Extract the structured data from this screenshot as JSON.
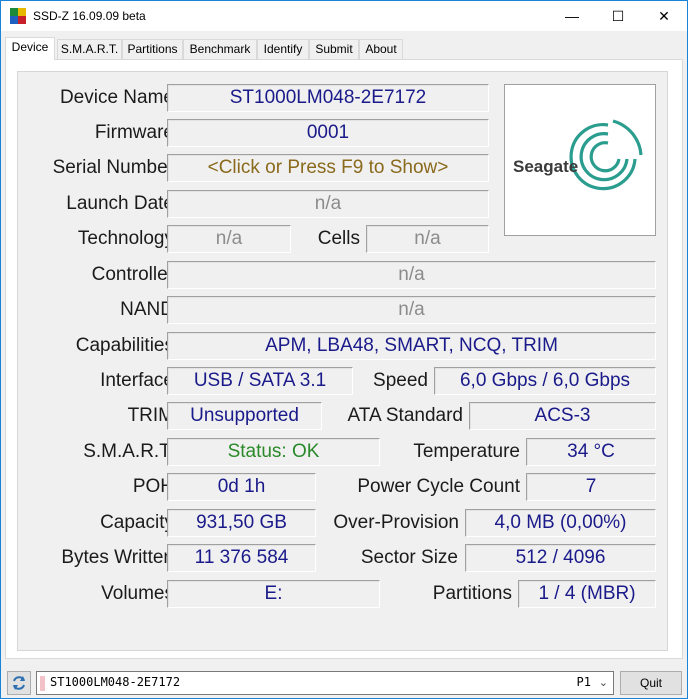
{
  "window": {
    "title": "SSD-Z 16.09.09 beta",
    "minimize": "—",
    "maximize": "☐",
    "close": "✕"
  },
  "tabs": [
    "Device",
    "S.M.A.R.T.",
    "Partitions",
    "Benchmark",
    "Identify",
    "Submit",
    "About"
  ],
  "active_tab": "Device",
  "device": {
    "device_name_label": "Device Name",
    "device_name": "ST1000LM048-2E7172",
    "firmware_label": "Firmware",
    "firmware": "0001",
    "serial_label": "Serial Number",
    "serial": "<Click or Press F9 to Show>",
    "launch_label": "Launch Date",
    "launch": "n/a",
    "technology_label": "Technology",
    "technology": "n/a",
    "cells_label": "Cells",
    "cells": "n/a",
    "controller_label": "Controller",
    "controller": "n/a",
    "nand_label": "NAND",
    "nand": "n/a",
    "capabilities_label": "Capabilities",
    "capabilities": "APM, LBA48, SMART, NCQ, TRIM",
    "interface_label": "Interface",
    "interface": "USB / SATA 3.1",
    "speed_label": "Speed",
    "speed": "6,0 Gbps / 6,0 Gbps",
    "trim_label": "TRIM",
    "trim": "Unsupported",
    "ata_label": "ATA Standard",
    "ata": "ACS-3",
    "smart_label": "S.M.A.R.T.",
    "smart": "Status: OK",
    "temp_label": "Temperature",
    "temp": "34 °C",
    "poh_label": "POH",
    "poh": "0d 1h",
    "pcc_label": "Power Cycle Count",
    "pcc": "7",
    "capacity_label": "Capacity",
    "capacity": "931,50 GB",
    "op_label": "Over-Provision",
    "op": "4,0 MB (0,00%)",
    "bw_label": "Bytes Written",
    "bw": "11 376 584",
    "sector_label": "Sector Size",
    "sector": "512 / 4096",
    "volumes_label": "Volumes",
    "volumes": "E:",
    "partitions_label": "Partitions",
    "partitions": "1 / 4 (MBR)",
    "logo_text": "Seagate"
  },
  "bottom": {
    "drive": "ST1000LM048-2E7172",
    "port": "P1",
    "quit": "Quit"
  },
  "colors": {
    "accent_border": "#1883d7",
    "value_text": "#1a1a8a",
    "ok_text": "#2a8a2a",
    "click_text": "#8a6a1c",
    "na_text": "#8c8c8c",
    "seagate_teal": "#2a9d8f"
  }
}
